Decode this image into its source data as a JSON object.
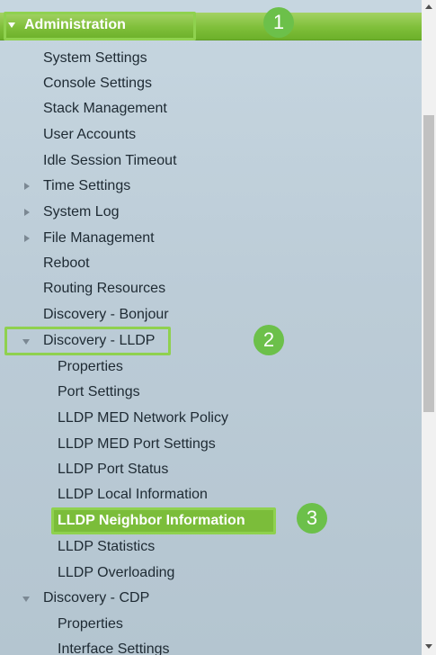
{
  "menu": {
    "header": "Administration",
    "items": [
      {
        "label": "System Settings"
      },
      {
        "label": "Console Settings"
      },
      {
        "label": "Stack Management"
      },
      {
        "label": "User Accounts"
      },
      {
        "label": "Idle Session Timeout"
      },
      {
        "label": "Time Settings"
      },
      {
        "label": "System Log"
      },
      {
        "label": "File Management"
      },
      {
        "label": "Reboot"
      },
      {
        "label": "Routing Resources"
      },
      {
        "label": "Discovery - Bonjour"
      },
      {
        "label": "Discovery - LLDP"
      },
      {
        "label": "Discovery - CDP"
      }
    ],
    "lldp_children": [
      {
        "label": "Properties"
      },
      {
        "label": "Port Settings"
      },
      {
        "label": "LLDP MED Network Policy"
      },
      {
        "label": "LLDP MED Port Settings"
      },
      {
        "label": "LLDP Port Status"
      },
      {
        "label": "LLDP Local Information"
      },
      {
        "label": "LLDP Neighbor Information"
      },
      {
        "label": "LLDP Statistics"
      },
      {
        "label": "LLDP Overloading"
      }
    ],
    "cdp_children": [
      {
        "label": "Properties"
      },
      {
        "label": "Interface Settings"
      }
    ]
  },
  "callouts": {
    "one": "1",
    "two": "2",
    "three": "3"
  },
  "colors": {
    "header_green": "#7fbf3a",
    "selected_green": "#7bbd3a",
    "highlight_border": "#8fd14f",
    "badge": "#6cc04a",
    "panel_bg": "#bfcfd9"
  }
}
